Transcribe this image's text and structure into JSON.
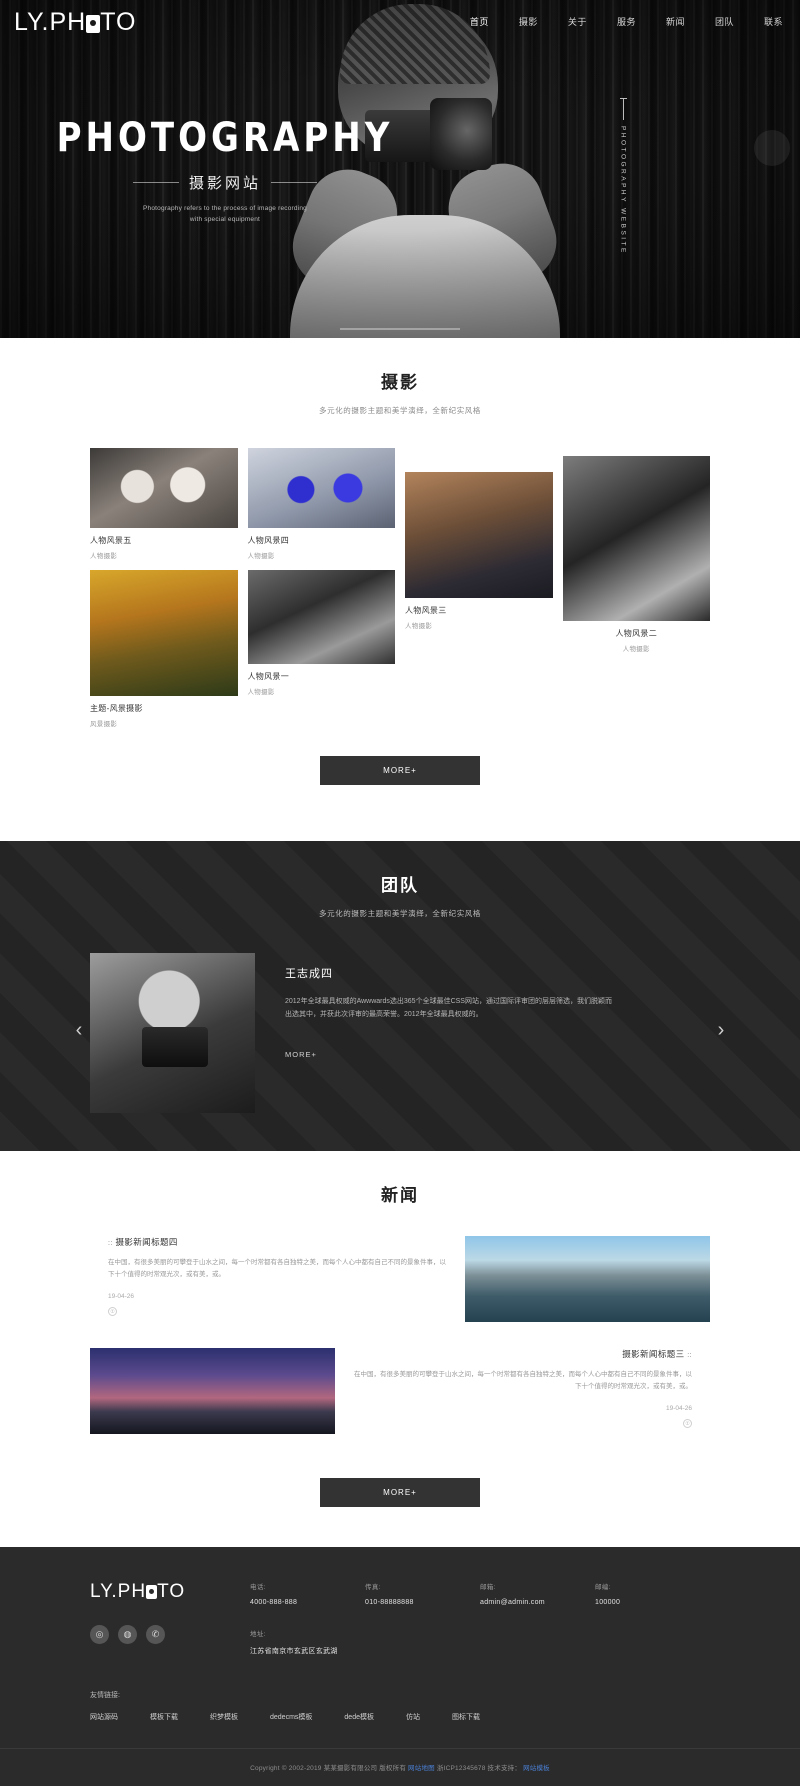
{
  "site": {
    "logo_text": "LY.PH",
    "logo_text_2": "TO",
    "nav": [
      {
        "label": "首页"
      },
      {
        "label": "摄影"
      },
      {
        "label": "关于"
      },
      {
        "label": "服务"
      },
      {
        "label": "新闻"
      },
      {
        "label": "团队"
      },
      {
        "label": "联系"
      }
    ]
  },
  "hero": {
    "title": "PHOTOGRAPHY",
    "subtitle": "摄影网站",
    "description": "Photography refers to the process of image recording with special equipment",
    "vertical_text": "PHOTOGRAPHY WEBSITE"
  },
  "photography": {
    "title": "摄影",
    "subtitle": "多元化的摄影主题和美学演绎，全新纪实风格",
    "items": [
      {
        "title": "人物风景五",
        "category": "人物摄影",
        "img": "kids"
      },
      {
        "title": "主题-风景摄影",
        "category": "风景摄影",
        "img": "autumn"
      },
      {
        "title": "人物风景四",
        "category": "人物摄影",
        "img": "gems"
      },
      {
        "title": "人物风景一",
        "category": "人物摄影",
        "img": "girl1"
      },
      {
        "title": "人物风景三",
        "category": "人物摄影",
        "img": "boy"
      },
      {
        "title": "人物风景二",
        "category": "人物摄影",
        "img": "girl2"
      }
    ],
    "more_label": "MORE+"
  },
  "team": {
    "title": "团队",
    "subtitle": "多元化的摄影主题和美学演绎，全新纪实风格",
    "member_name": "王志成四",
    "member_desc": "2012年全球最具权威的Awwwards选出365个全球最佳CSS网站，通过国际评审团的层层筛选，我们脱颖而出选其中，并获此次评审的最高荣誉。2012年全球最具权威的。",
    "more_label": "MORE+",
    "prev_icon": "chevron-left-icon",
    "next_icon": "chevron-right-icon"
  },
  "news": {
    "title": "新闻",
    "items": [
      {
        "title": "摄影新闻标题四",
        "marker": "::",
        "desc": "在中国，有很多美丽的可攀登于山水之间，每一个时常都有各自独特之美，而每个人心中都有自己不同的景象件事，以下十个值得的时常观光次，或有美，或。",
        "date": "19-04-26",
        "badge": "①",
        "img": "lake"
      },
      {
        "title": "摄影新闻标题三",
        "marker": "::",
        "desc": "在中国，有很多美丽的可攀登于山水之间，每一个时常都有各自独特之美，而每个人心中都有自己不同的景象件事，以下十个值得的时常观光次，或有美，或。",
        "date": "19-04-26",
        "badge": "①",
        "img": "night"
      }
    ],
    "more_label": "MORE+"
  },
  "footer": {
    "logo_text": "LY.PH",
    "logo_text_2": "TO",
    "social": [
      "weibo-icon",
      "qq-icon",
      "wechat-icon"
    ],
    "social_glyphs": [
      "◎",
      "◍",
      "✆"
    ],
    "contacts": [
      {
        "label": "电话:",
        "value": "4000-888-888"
      },
      {
        "label": "传真:",
        "value": "010-88888888"
      },
      {
        "label": "邮箱:",
        "value": "admin@admin.com"
      },
      {
        "label": "邮编:",
        "value": "100000"
      }
    ],
    "address_label": "地址:",
    "address_value": "江苏省南京市玄武区玄武湖",
    "links_label": "友情链接:",
    "links": [
      "网站源码",
      "模板下载",
      "织梦模板",
      "dedecms模板",
      "dede模板",
      "仿站",
      "图标下载"
    ],
    "copyright_pre": "Copyright © 2002-2019 某某摄影有限公司 版权所有",
    "copyright_link1": "网站地图",
    "copyright_icp": "浙ICP12345678",
    "copyright_mid": "技术支持：",
    "copyright_link2": "网站模板"
  },
  "colors": {
    "dark": "#2b2b2b",
    "button": "#333333",
    "link": "#4a7fd4"
  }
}
